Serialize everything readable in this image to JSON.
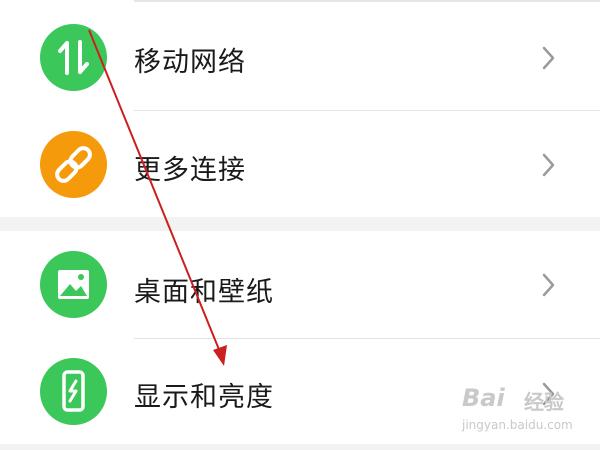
{
  "settings": {
    "items": [
      {
        "label": "移动网络",
        "icon": "arrows-updown-icon",
        "color": "#3cc75a"
      },
      {
        "label": "更多连接",
        "icon": "link-icon",
        "color": "#f59a0b"
      },
      {
        "label": "桌面和壁纸",
        "icon": "image-icon",
        "color": "#3cc75a"
      },
      {
        "label": "显示和亮度",
        "icon": "phone-brightness-icon",
        "color": "#3cc75a"
      }
    ]
  },
  "watermark": {
    "brand": "Bai",
    "brand_cn": "经验",
    "url": "jingyan.baidu.com"
  },
  "colors": {
    "annotation_arrow": "#cc1f1f",
    "chevron": "#9a9a9a"
  }
}
